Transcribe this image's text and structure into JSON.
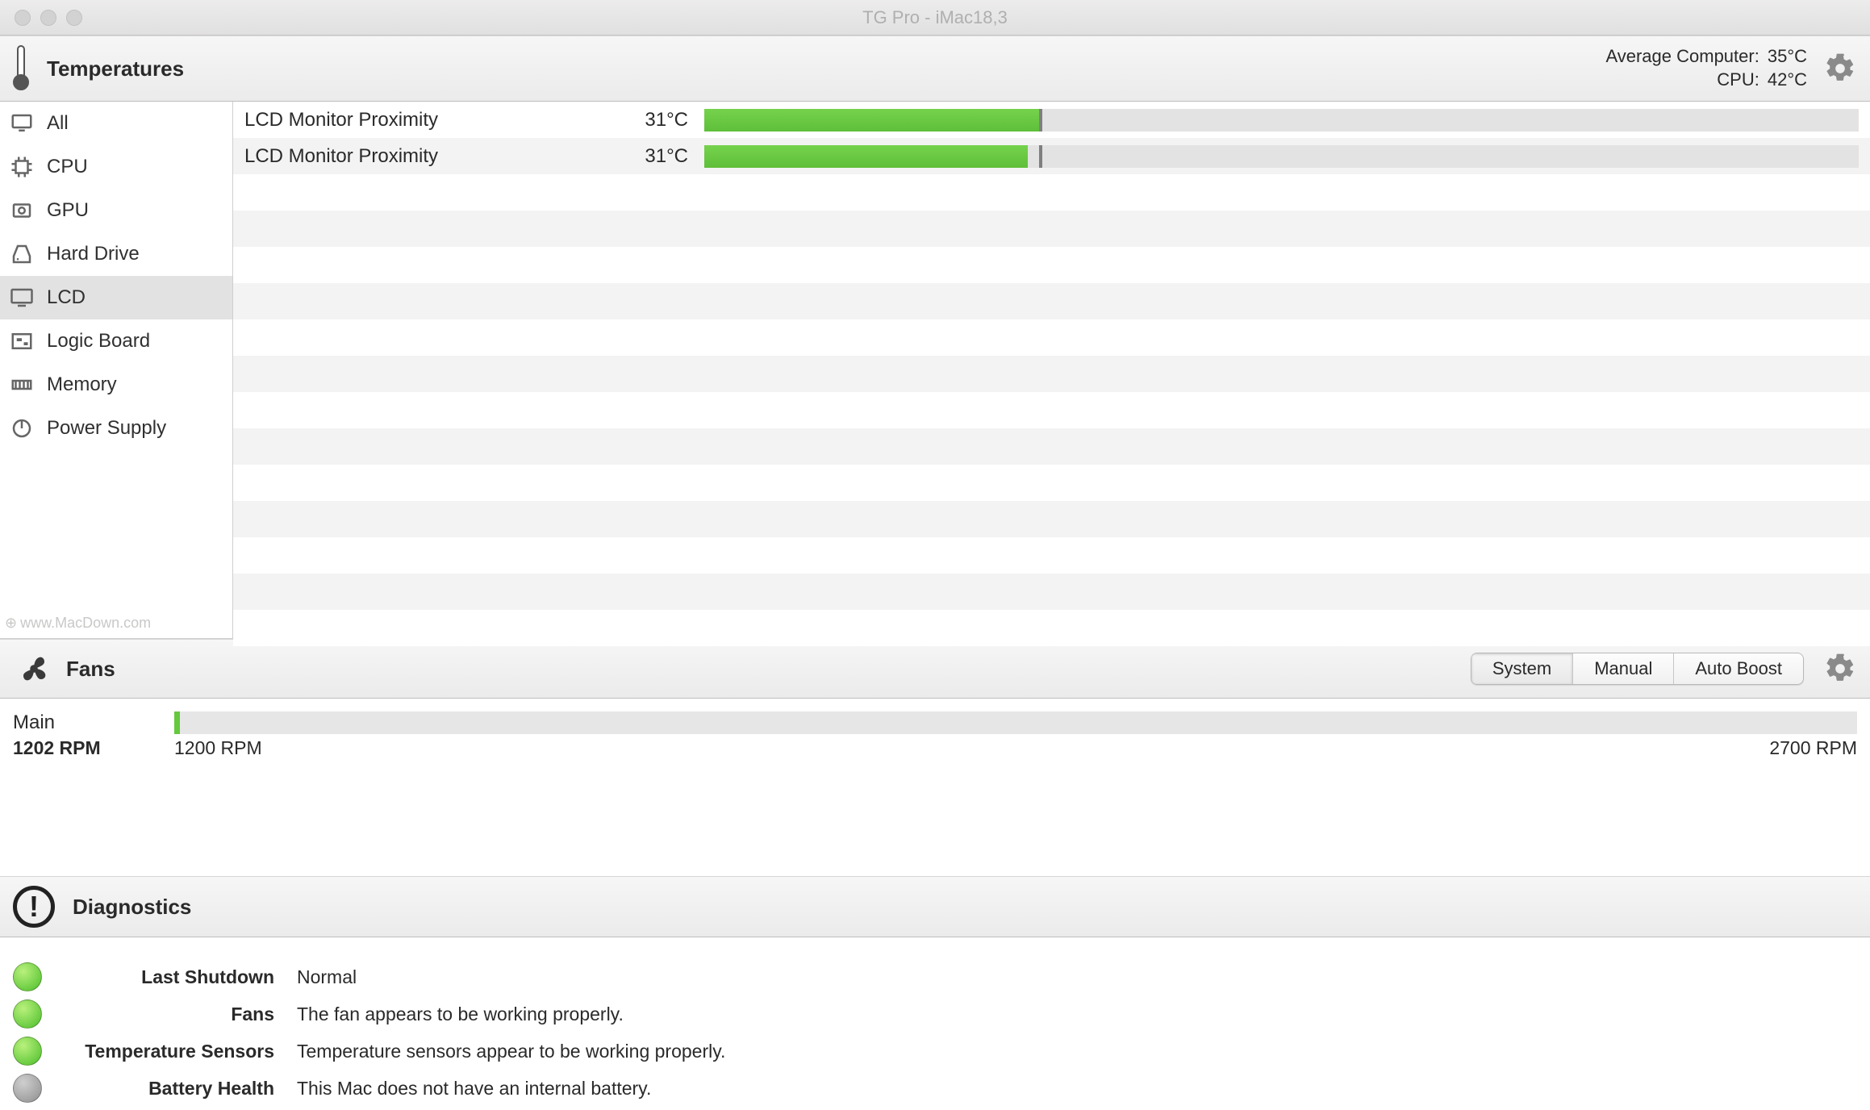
{
  "window_title": "TG Pro - iMac18,3",
  "temperatures": {
    "heading": "Temperatures",
    "avg_computer_label": "Average Computer:",
    "avg_computer_value": "35°C",
    "cpu_label": "CPU:",
    "cpu_value": "42°C",
    "sidebar": [
      {
        "label": "All",
        "icon": "display"
      },
      {
        "label": "CPU",
        "icon": "cpu"
      },
      {
        "label": "GPU",
        "icon": "gpu"
      },
      {
        "label": "Hard Drive",
        "icon": "hdd"
      },
      {
        "label": "LCD",
        "icon": "lcd"
      },
      {
        "label": "Logic Board",
        "icon": "board"
      },
      {
        "label": "Memory",
        "icon": "memory"
      },
      {
        "label": "Power Supply",
        "icon": "power"
      }
    ],
    "selected_sidebar_index": 4,
    "sensors": [
      {
        "name": "LCD Monitor Proximity",
        "value": "31°C",
        "bar_pct": 29,
        "tick_pct": 29
      },
      {
        "name": "LCD Monitor Proximity",
        "value": "31°C",
        "bar_pct": 28,
        "tick_pct": 29
      }
    ],
    "watermark": "www.MacDown.com"
  },
  "fans": {
    "heading": "Fans",
    "modes": [
      "System",
      "Manual",
      "Auto Boost"
    ],
    "selected_mode_index": 0,
    "fan": {
      "name": "Main",
      "rpm_current": "1202 RPM",
      "rpm_min": "1200 RPM",
      "rpm_max": "2700 RPM"
    }
  },
  "diagnostics": {
    "heading": "Diagnostics",
    "rows": [
      {
        "led": "green",
        "label": "Last Shutdown",
        "value": "Normal"
      },
      {
        "led": "green",
        "label": "Fans",
        "value": "The fan appears to be working properly."
      },
      {
        "led": "green",
        "label": "Temperature Sensors",
        "value": "Temperature sensors appear to be working properly."
      },
      {
        "led": "gray",
        "label": "Battery Health",
        "value": "This Mac does not have an internal battery."
      }
    ]
  }
}
